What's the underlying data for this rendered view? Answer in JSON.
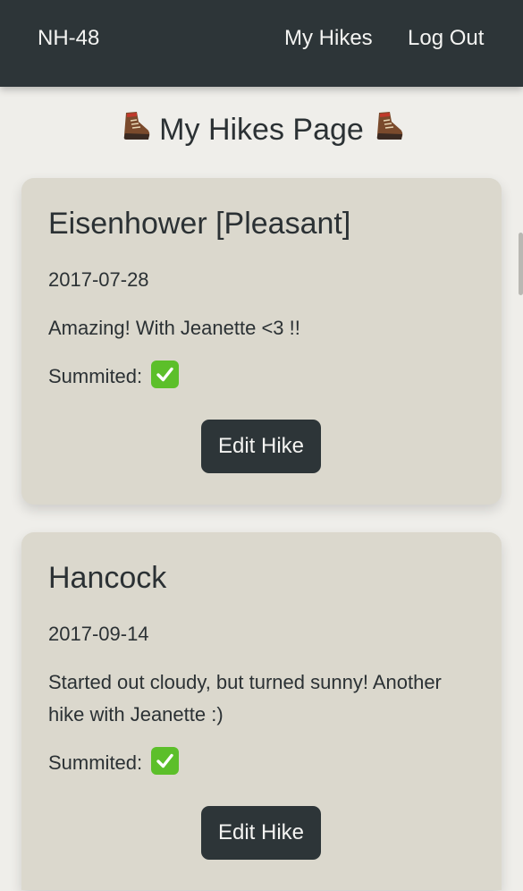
{
  "nav": {
    "brand": "NH-48",
    "my_hikes": "My Hikes",
    "log_out": "Log Out"
  },
  "page": {
    "title": "My Hikes Page",
    "title_icon": "hiking-boot-icon"
  },
  "hikes": [
    {
      "name": "Eisenhower [Pleasant]",
      "date": "2017-07-28",
      "notes": "Amazing! With Jeanette <3 !!",
      "summited_label": "Summited:",
      "summited": true,
      "edit_label": "Edit Hike"
    },
    {
      "name": "Hancock",
      "date": "2017-09-14",
      "notes": "Started out cloudy, but turned sunny! Another hike with Jeanette :)",
      "summited_label": "Summited:",
      "summited": true,
      "edit_label": "Edit Hike"
    }
  ],
  "colors": {
    "navbar": "#2d3538",
    "background": "#efeeea",
    "card": "#dbd8cd",
    "button": "#2d3538",
    "check": "#5cbf2a"
  }
}
